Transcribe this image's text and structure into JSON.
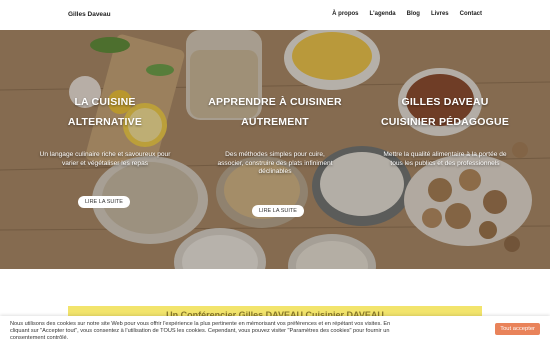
{
  "header": {
    "brand": "Gilles Daveau",
    "nav": [
      "À propos",
      "L'agenda",
      "Blog",
      "Livres",
      "Contact"
    ]
  },
  "hero": {
    "columns": [
      {
        "title_line1": "LA CUISINE",
        "title_line2": "ALTERNATIVE",
        "text": "Un langage culinaire riche et savoureux pour varier et végétaliser les repas",
        "button": "LIRE LA SUITE"
      },
      {
        "title_line1": "APPRENDRE À CUISINER",
        "title_line2": "AUTREMENT",
        "text": "Des méthodes simples pour cuire, associer, construire des plats infiniment déclinables",
        "button": "LIRE LA SUITE"
      },
      {
        "title_line1": "GILLES DAVEAU",
        "title_line2": "CUISINIER PÉDAGOGUE",
        "text": "Mettre la qualité alimentaire à la portée de tous les publics et des professionnels",
        "button": ""
      }
    ]
  },
  "banner": {
    "text": "Un Conférencier Gilles DAVEAU Cuisinier DAVEAU"
  },
  "cookie": {
    "text": "Nous utilisons des cookies sur notre site Web pour vous offrir l'expérience la plus pertinente en mémorisant vos préférences et en répétant vos visites. En cliquant sur \"Accepter tout\", vous consentez à l'utilisation de TOUS les cookies. Cependant, vous pouvez visiter \"Paramètres des cookies\" pour fournir un consentement contrôlé.",
    "accept": "Tout accepter"
  }
}
